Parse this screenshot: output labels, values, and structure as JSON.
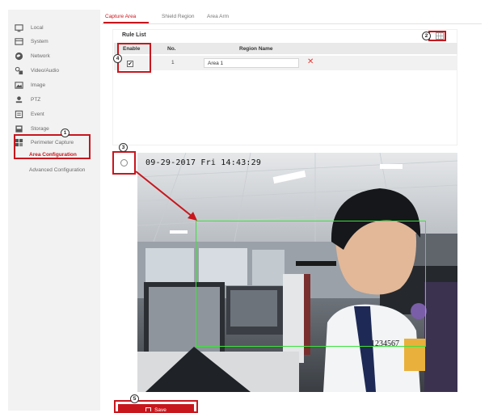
{
  "sidebar": {
    "items": [
      {
        "label": "Local",
        "icon": "monitor-icon"
      },
      {
        "label": "System",
        "icon": "system-icon"
      },
      {
        "label": "Network",
        "icon": "globe-icon"
      },
      {
        "label": "Video/Audio",
        "icon": "video-audio-icon"
      },
      {
        "label": "Image",
        "icon": "image-icon"
      },
      {
        "label": "PTZ",
        "icon": "ptz-icon"
      },
      {
        "label": "Event",
        "icon": "event-icon"
      },
      {
        "label": "Storage",
        "icon": "storage-icon"
      },
      {
        "label": "Perimeter Capture",
        "icon": "perimeter-icon"
      }
    ],
    "subitems": [
      {
        "label": "Area Configuration",
        "active": true
      },
      {
        "label": "Advanced Configuration",
        "active": false
      }
    ]
  },
  "tabs": [
    {
      "label": "Capture Area",
      "active": true
    },
    {
      "label": "Shield Region",
      "active": false
    },
    {
      "label": "Area Arm",
      "active": false
    }
  ],
  "rule_list": {
    "title": "Rule List",
    "columns": [
      "Enable",
      "No.",
      "Region Name"
    ],
    "rows": [
      {
        "enabled": true,
        "check_mark": "✔",
        "no": "1",
        "region_name": "Area 1",
        "delete_glyph": "✕"
      }
    ]
  },
  "video": {
    "timestamp": "09-29-2017 Fri 14:43:29",
    "device_id": "1234567"
  },
  "save_label": "Save",
  "annotations": [
    "1",
    "2",
    "3",
    "4",
    "5"
  ],
  "colors": {
    "accent": "#c8161d",
    "capture_box": "#3be23b",
    "delete": "#e53935"
  }
}
